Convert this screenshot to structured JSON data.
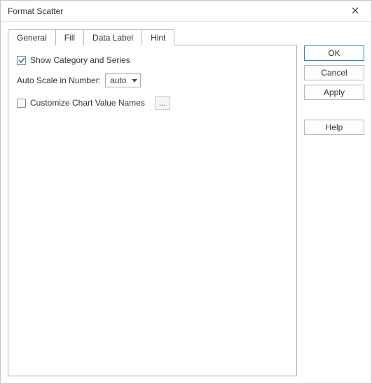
{
  "title": "Format Scatter",
  "tabs": {
    "general": "General",
    "fill": "Fill",
    "data_label": "Data Label",
    "hint": "Hint",
    "active": "hint"
  },
  "hint": {
    "show_category": {
      "checked": true,
      "label": "Show Category and Series"
    },
    "auto_scale_label": "Auto Scale in Number:",
    "auto_scale_value": "auto",
    "customize": {
      "checked": false,
      "label": "Customize Chart Value Names"
    },
    "ellipsis": "..."
  },
  "buttons": {
    "ok": "OK",
    "cancel": "Cancel",
    "apply": "Apply",
    "help": "Help"
  }
}
